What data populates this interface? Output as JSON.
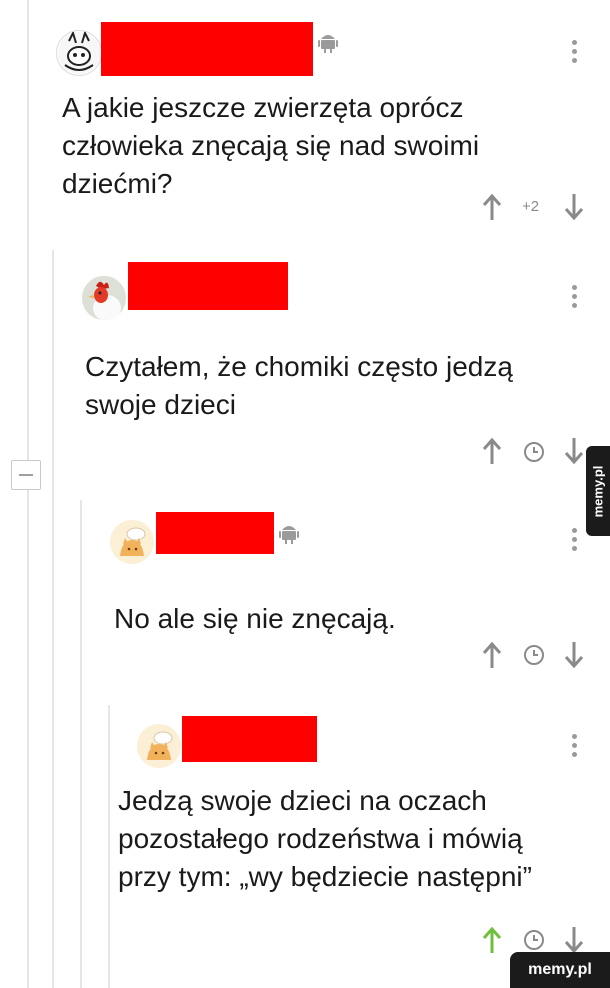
{
  "comments": [
    {
      "text_lines": [
        "A jakie jeszcze zwierzęta oprócz",
        "człowieka znęcają się nad swoimi",
        "dziećmi?"
      ],
      "score": "+2",
      "platform_icon": "android-icon",
      "avatar": "rabbit-sketch-avatar"
    },
    {
      "text_lines": [
        "Czytałem, że chomiki często jedzą",
        "swoje dzieci"
      ],
      "avatar": "rooster-avatar"
    },
    {
      "text_lines": [
        "No ale się nie znęcają."
      ],
      "platform_icon": "android-icon",
      "avatar": "cat-chef-avatar"
    },
    {
      "text_lines": [
        "Jedzą swoje dzieci na oczach",
        "pozostałego rodzeństwa i mówią",
        "przy tym: „wy będziecie następni”"
      ],
      "avatar": "cat-chef-avatar",
      "upvoted": true
    }
  ],
  "watermark": {
    "side": "memy.pl",
    "bottom": "memy.pl"
  },
  "colors": {
    "redaction": "#ff0000",
    "upvote_active": "#6fbf3c",
    "icon_gray": "#8a8a8a"
  }
}
